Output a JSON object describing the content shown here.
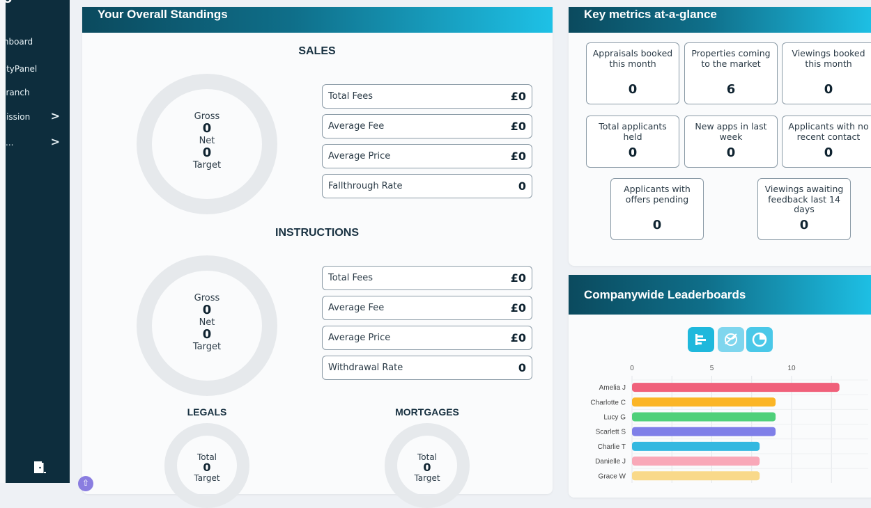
{
  "sidebar": {
    "brand": "PRO",
    "items": [
      {
        "label": "Dashboard"
      },
      {
        "label": "ActivityPanel"
      },
      {
        "label": "My Branch"
      },
      {
        "label": "Commission",
        "chevron": ">"
      },
      {
        "label": "...",
        "chevron": ">"
      }
    ]
  },
  "standings": {
    "title": "Your Overall Standings",
    "sales": {
      "title": "SALES",
      "donut": {
        "gross_label": "Gross",
        "gross": "0",
        "net_label": "Net",
        "net": "0",
        "target_label": "Target"
      },
      "stats": [
        {
          "label": "Total Fees",
          "value": "£0"
        },
        {
          "label": "Average Fee",
          "value": "£0"
        },
        {
          "label": "Average Price",
          "value": "£0"
        },
        {
          "label": "Fallthrough Rate",
          "value": "0"
        }
      ]
    },
    "instructions": {
      "title": "INSTRUCTIONS",
      "donut": {
        "gross_label": "Gross",
        "gross": "0",
        "net_label": "Net",
        "net": "0",
        "target_label": "Target"
      },
      "stats": [
        {
          "label": "Total Fees",
          "value": "£0"
        },
        {
          "label": "Average Fee",
          "value": "£0"
        },
        {
          "label": "Average Price",
          "value": "£0"
        },
        {
          "label": "Withdrawal Rate",
          "value": "0"
        }
      ]
    },
    "legals": {
      "title": "LEGALS",
      "total_label": "Total",
      "total": "0",
      "target_label": "Target"
    },
    "mortgages": {
      "title": "MORTGAGES",
      "total_label": "Total",
      "total": "0",
      "target_label": "Target"
    }
  },
  "metrics": {
    "title": "Key metrics at-a-glance",
    "cards": [
      {
        "label": "Appraisals booked this month",
        "value": "0"
      },
      {
        "label": "Properties coming to the market",
        "value": "6"
      },
      {
        "label": "Viewings booked this month",
        "value": "0"
      },
      {
        "label": "Total applicants held",
        "value": "0"
      },
      {
        "label": "New apps in last week",
        "value": "0"
      },
      {
        "label": "Applicants with no recent contact",
        "value": "0"
      },
      {
        "label": "Applicants with offers pending",
        "value": "0"
      },
      {
        "label": "Viewings awaiting feedback last 14 days",
        "value": "0"
      }
    ]
  },
  "leaderboards": {
    "title": "Companywide Leaderboards",
    "toggles": [
      {
        "icon": "bar-chart-icon",
        "color": "#1fb8dc"
      },
      {
        "icon": "globe-icon",
        "color": "#7fd6ee"
      },
      {
        "icon": "pie-chart-icon",
        "color": "#4ac8e8"
      }
    ]
  },
  "chart_data": {
    "type": "bar",
    "orientation": "horizontal",
    "categories": [
      "Amelia J",
      "Charlotte C",
      "Lucy G",
      "Scarlett S",
      "Charlie T",
      "Danielle J",
      "Grace W"
    ],
    "values": [
      13,
      9,
      9,
      9,
      8,
      8,
      8
    ],
    "colors": [
      "#f0607a",
      "#fbb526",
      "#4fd07a",
      "#7f7fe8",
      "#33b8e0",
      "#f9a8b8",
      "#f9d98a"
    ],
    "x_ticks": [
      "0",
      "5",
      "10"
    ],
    "xlim": [
      0,
      14
    ],
    "grid": true
  }
}
